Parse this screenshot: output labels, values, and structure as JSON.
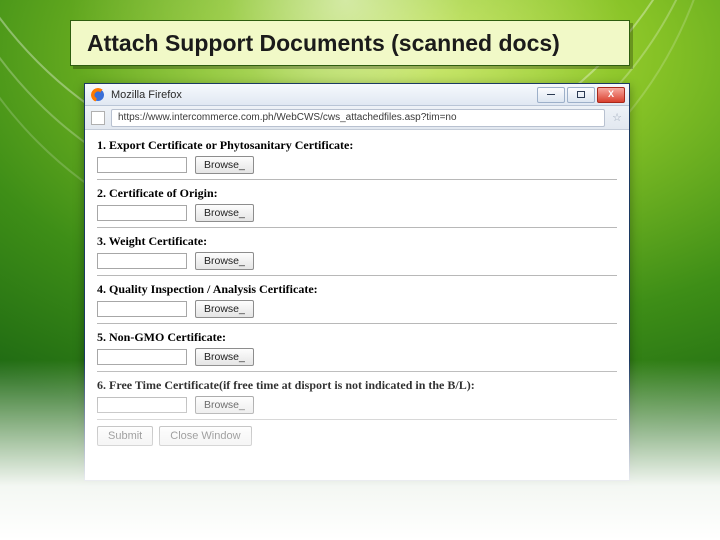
{
  "slide": {
    "title": "Attach Support Documents (scanned docs)"
  },
  "window": {
    "app_name": "Mozilla Firefox",
    "url": "https://www.intercommerce.com.ph/WebCWS/cws_attachedfiles.asp?tim=no",
    "min_tooltip": "Minimize",
    "max_tooltip": "Maximize",
    "close_label": "X"
  },
  "form": {
    "browse_label": "Browse_",
    "docs": [
      {
        "n": "1.",
        "label": "Export Certificate or Phytosanitary Certificate:"
      },
      {
        "n": "2.",
        "label": "Certificate of Origin:"
      },
      {
        "n": "3.",
        "label": "Weight Certificate:"
      },
      {
        "n": "4.",
        "label": "Quality Inspection / Analysis Certificate:"
      },
      {
        "n": "5.",
        "label": "Non-GMO Certificate:"
      },
      {
        "n": "6.",
        "label": "Free Time Certificate(if free time at disport is not indicated in the B/L):"
      }
    ],
    "submit_label": "Submit",
    "close_window_label": "Close Window"
  }
}
